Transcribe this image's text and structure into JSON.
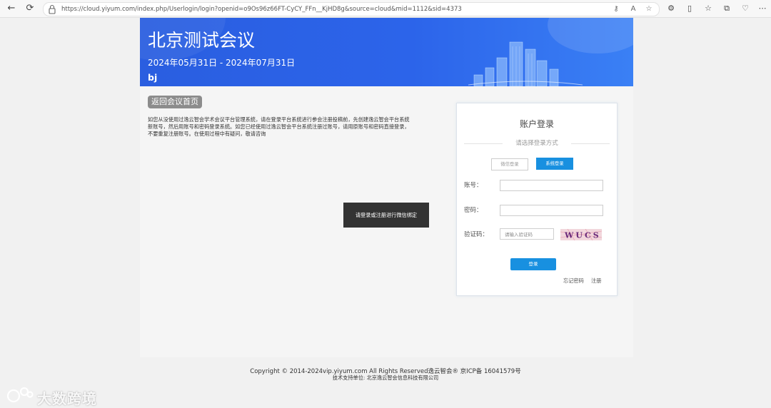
{
  "browser": {
    "url": "https://cloud.yiyum.com/index.php/Userlogin/login?openid=o9Os96z66FT-CyCY_FFn__KjHD8g&source=cloud&mid=1112&sid=4373"
  },
  "banner": {
    "title": "北京测试会议",
    "dates": "2024年05月31日 - 2024年07月31日",
    "location": "bj"
  },
  "main": {
    "back_button": "返回会议首页",
    "intro": "如您从没使用过逸云智会学术会议平台管理系统，请在登录平台系统进行参会注册投稿前，先创建逸云智会平台系统新账号，然后用账号和密码登录系统。如您已经使用过逸云智会平台系统注册过账号，请用原账号和密码直接登录，不要重复注册账号。在使用过程中有疑问，敬请咨询",
    "toast": "请登录或注册进行微信绑定"
  },
  "login": {
    "title": "账户登录",
    "method_prompt": "请选择登录方式",
    "tab_wechat": "微信登录",
    "tab_system": "系统登录",
    "account_label": "账号：",
    "password_label": "密码：",
    "captcha_label": "验证码：",
    "captcha_placeholder": "请输入验证码",
    "captcha_text": "WUCS",
    "login_button": "登录",
    "forgot_link": "忘记密码",
    "register_link": "注册"
  },
  "footer": {
    "copyright": "Copyright © 2014-2024vip.yiyum.com All Rights Reserved逸云智会® 京ICP备 16041579号",
    "support": "技术支持单位:   北京逸云智会信息科技有限公司"
  },
  "watermark": {
    "text": "大数跨境"
  }
}
